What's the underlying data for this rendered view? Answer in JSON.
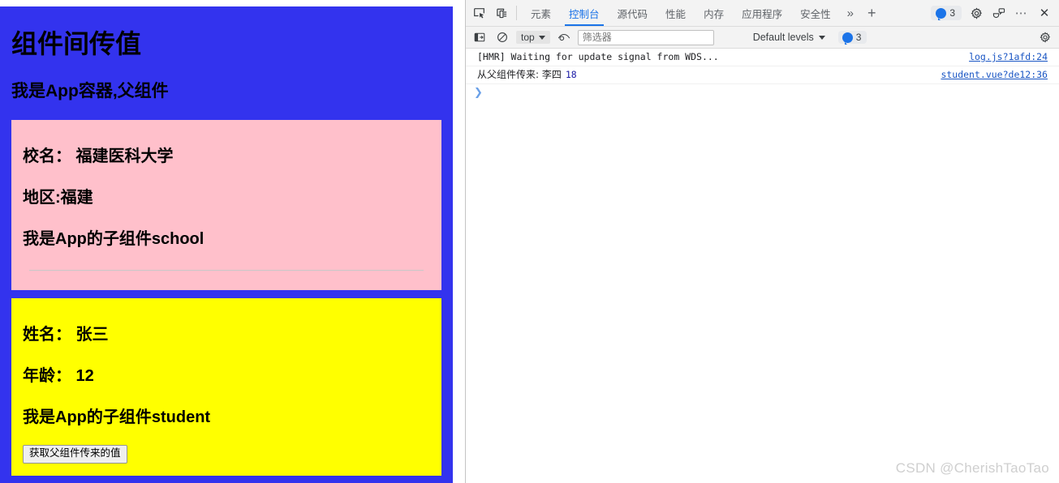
{
  "colors": {
    "app_background": "#3333ee",
    "school_card_background": "#ffc0cb",
    "student_card_background": "#ffff00",
    "devtools_accent": "#1a73e8",
    "console_link": "#1a56c4",
    "console_number": "#1a1aa6",
    "watermark": "#cfcfcf"
  },
  "page": {
    "title": "组件间传值",
    "subtitle": "我是App容器,父组件",
    "school_card": {
      "school_name_line": "校名： 福建医科大学",
      "region_line": "地区:福建",
      "identity_line": "我是App的子组件school",
      "divider": "hr"
    },
    "student_card": {
      "name_line": "姓名： 张三",
      "age_line": "年龄： 12",
      "identity_line": "我是App的子组件student",
      "button_label": "获取父组件传来的值"
    }
  },
  "devtools": {
    "toolbar_icons": {
      "inspect": "inspect-element-icon",
      "device": "device-toolbar-icon"
    },
    "tabs": [
      {
        "label": "元素",
        "active": false
      },
      {
        "label": "控制台",
        "active": true
      },
      {
        "label": "源代码",
        "active": false
      },
      {
        "label": "性能",
        "active": false
      },
      {
        "label": "内存",
        "active": false
      },
      {
        "label": "应用程序",
        "active": false
      },
      {
        "label": "安全性",
        "active": false
      }
    ],
    "more_tabs_label": "»",
    "add_tab_label": "+",
    "issues_count": "3",
    "settings_icon": "gear-icon",
    "customize_icon": "feedback-icon",
    "more_options_label": "⋯",
    "close_label": "✕",
    "console_toolbar": {
      "sidebar_toggle": "console-sidebar-icon",
      "clear_label": "clear-console-icon",
      "context": "top",
      "eye_icon": "live-expression-icon",
      "filter_placeholder": "筛选器",
      "filter_value": "",
      "levels_label": "Default levels",
      "issues_badge": "3"
    },
    "console_messages": [
      {
        "text": "[HMR] Waiting for update signal from WDS...",
        "number": "",
        "source": "log.js?1afd:24",
        "cjk": false
      },
      {
        "text": "从父组件传来: 李四",
        "number": "18",
        "source": "student.vue?de12:36",
        "cjk": true
      }
    ],
    "prompt_symbol": "❯"
  },
  "watermark": "CSDN @CherishTaoTao"
}
